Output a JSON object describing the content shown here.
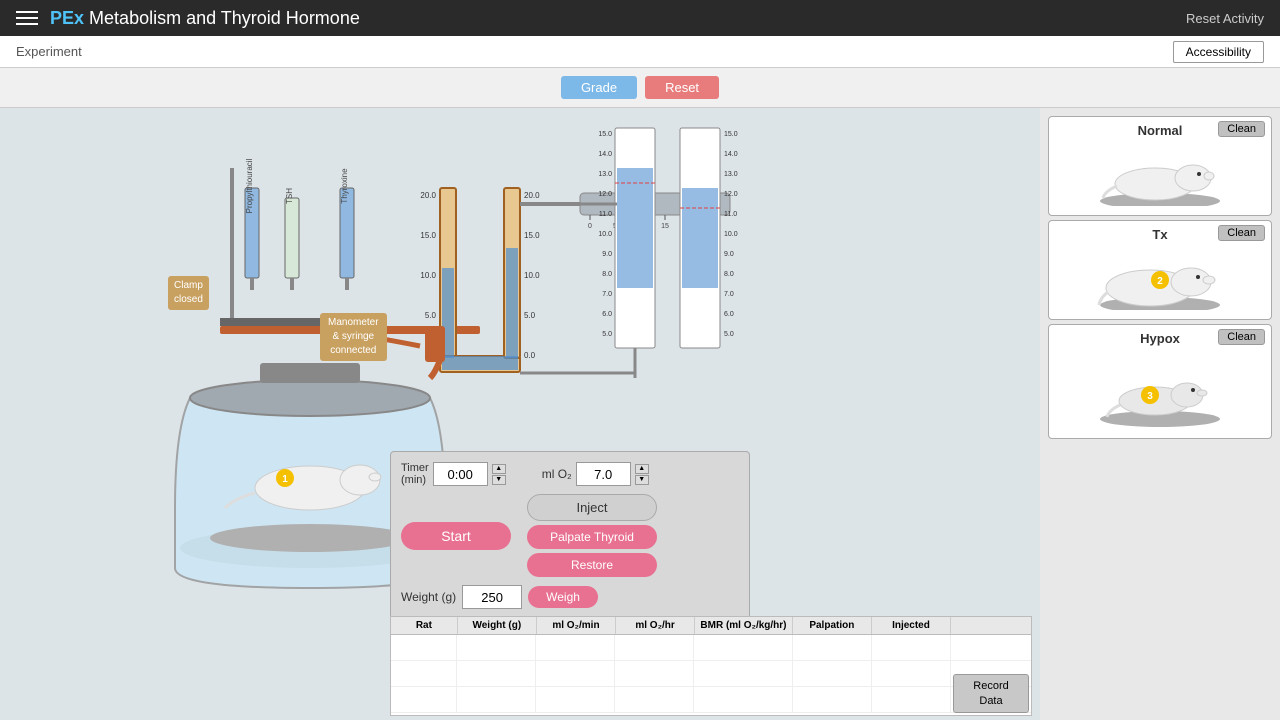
{
  "header": {
    "menu_icon": "menu-icon",
    "pex_label": "PEx",
    "title": "Metabolism and Thyroid Hormone",
    "reset_activity": "Reset Activity"
  },
  "subheader": {
    "experiment_label": "Experiment",
    "accessibility_label": "Accessibility"
  },
  "topbar": {
    "grade_label": "Grade",
    "reset_label": "Reset"
  },
  "right_panel": {
    "normal": {
      "label": "Normal",
      "clean_label": "Clean"
    },
    "tx": {
      "label": "Tx",
      "clean_label": "Clean"
    },
    "hypox": {
      "label": "Hypox",
      "clean_label": "Clean"
    }
  },
  "controls": {
    "timer_label": "Timer\n(min)",
    "timer_value": "0:00",
    "mlo2_label": "ml O₂",
    "mlo2_value": "7.0",
    "start_label": "Start",
    "inject_label": "Inject",
    "palpate_label": "Palpate Thyroid",
    "restore_label": "Restore",
    "weight_label": "Weight (g)",
    "weight_value": "250",
    "weigh_label": "Weigh"
  },
  "equipment": {
    "clamp_label": "Clamp\nclosed",
    "manometer_label": "Manometer\n& syringe\nconnected",
    "syringes": [
      {
        "label": "Propylthiouracil",
        "color": "blue"
      },
      {
        "label": "TSH",
        "color": "clear"
      },
      {
        "label": "Thyroxine",
        "color": "blue"
      }
    ]
  },
  "table": {
    "columns": [
      {
        "id": "rat",
        "label": "Rat"
      },
      {
        "id": "weight",
        "label": "Weight (g)"
      },
      {
        "id": "mlo2_min",
        "label": "ml O₂/min"
      },
      {
        "id": "mlo2_hr",
        "label": "ml O₂/hr"
      },
      {
        "id": "bmr",
        "label": "BMR (ml O₂/kg/hr)"
      },
      {
        "id": "palpation",
        "label": "Palpation"
      },
      {
        "id": "injected",
        "label": "Injected"
      }
    ],
    "rows": [],
    "record_label": "Record\nData"
  },
  "gauges": {
    "left": {
      "max": 15.0,
      "values": [
        15.0,
        14.0,
        13.0,
        12.0,
        11.0,
        10.0,
        9.0,
        8.0,
        7.0,
        6.0,
        5.0
      ],
      "fill_value": 12.0
    },
    "right": {
      "max": 15.0,
      "values": [
        15.0,
        14.0,
        13.0,
        12.0,
        11.0,
        10.0,
        9.0,
        8.0,
        7.0,
        6.0,
        5.0
      ],
      "fill_value": 10.0
    }
  },
  "badge_numbers": {
    "rat1": "1",
    "rat2": "2",
    "rat3": "3"
  }
}
